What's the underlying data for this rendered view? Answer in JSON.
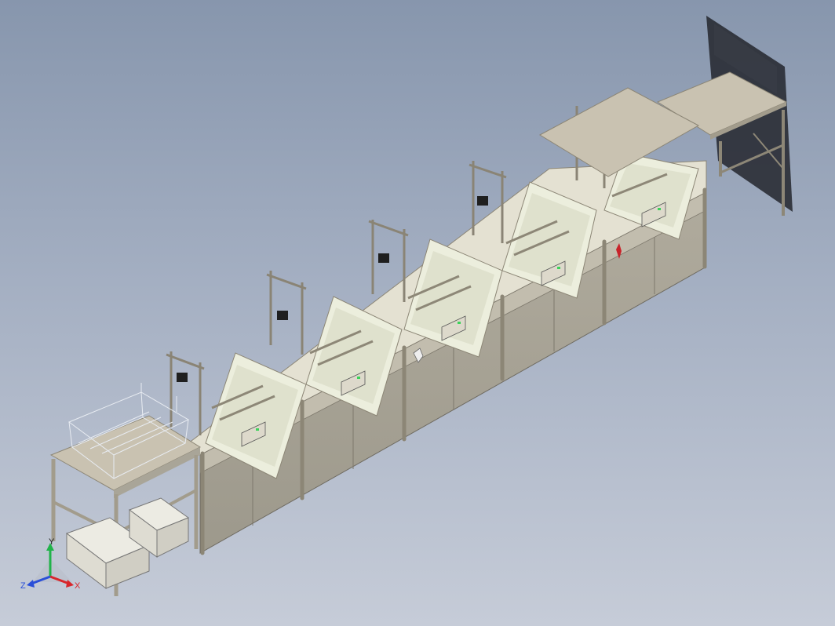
{
  "viewport": {
    "background_top": "#8796ad",
    "background_bottom": "#c6ccd8"
  },
  "model": {
    "frame_color": "#c9c2b1",
    "panel_color": "#a9a598",
    "tank_inner_color": "#eceedd",
    "tank_count": 5,
    "features": [
      "loading-table-with-basket",
      "ultrasonic-generator-boxes",
      "tank-lift-mechanisms",
      "control-panels",
      "unloading-table"
    ]
  },
  "triad": {
    "x_label": "X",
    "y_label": "Y",
    "z_label": "Z",
    "x_color": "#d8262b",
    "y_color": "#20b34a",
    "z_color": "#2a4fd8"
  }
}
